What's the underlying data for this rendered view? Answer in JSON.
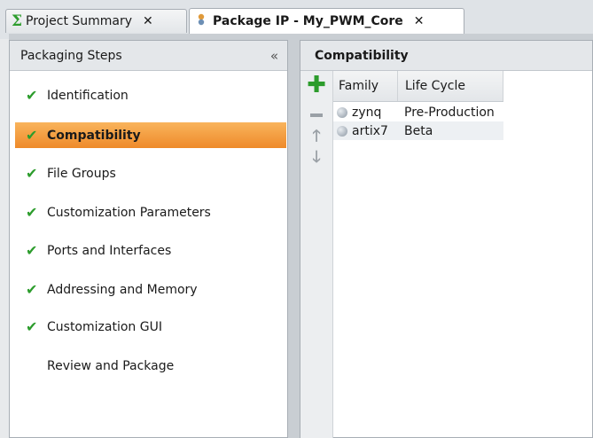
{
  "tabs": [
    {
      "label": "Project Summary",
      "icon": "sigma-icon",
      "active": false
    },
    {
      "label": "Package IP - My_PWM_Core",
      "icon": "package-icon",
      "active": true
    }
  ],
  "close_glyph": "✕",
  "left_panel": {
    "title": "Packaging Steps",
    "collapse_glyph": "«",
    "steps": [
      {
        "label": "Identification",
        "done": true
      },
      {
        "label": "Compatibility",
        "done": true,
        "selected": true
      },
      {
        "label": "File Groups",
        "done": true
      },
      {
        "label": "Customization Parameters",
        "done": true
      },
      {
        "label": "Ports and Interfaces",
        "done": true
      },
      {
        "label": "Addressing and Memory",
        "done": true
      },
      {
        "label": "Customization GUI",
        "done": true
      },
      {
        "label": "Review and Package",
        "done": false
      }
    ]
  },
  "right_panel": {
    "title": "Compatibility",
    "columns": [
      "Family",
      "Life Cycle"
    ],
    "rows": [
      {
        "family": "zynq",
        "life_cycle": "Pre-Production"
      },
      {
        "family": "artix7",
        "life_cycle": "Beta"
      }
    ]
  },
  "colors": {
    "selection": "#ee8a2a",
    "check": "#2c9c2c"
  }
}
